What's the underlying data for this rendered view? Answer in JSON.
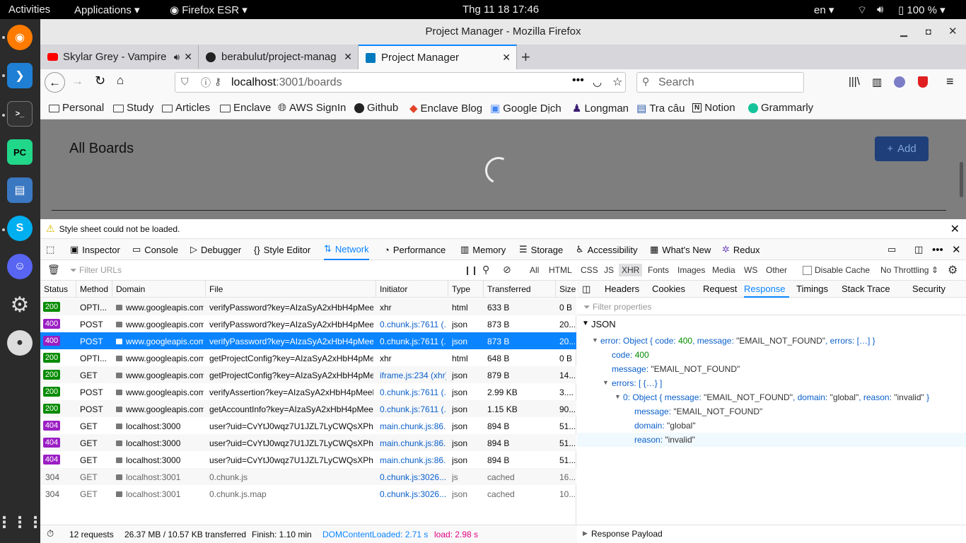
{
  "topbar": {
    "activities": "Activities",
    "applications": "Applications",
    "app": "Firefox ESR",
    "clock": "Thg 11 18  17:46",
    "lang": "en",
    "battery": "100 %"
  },
  "window": {
    "title": "Project Manager - Mozilla Firefox"
  },
  "tabs": [
    {
      "label": "Skylar Grey - Vampire"
    },
    {
      "label": "berabulut/project-manag"
    },
    {
      "label": "Project Manager"
    }
  ],
  "url": {
    "host": "localhost",
    "rest": ":3001/boards"
  },
  "search": {
    "placeholder": "Search"
  },
  "bookmarks": [
    "Personal",
    "Study",
    "Articles",
    "Enclave",
    "AWS SignIn",
    "Github",
    "Enclave Blog",
    "Google Dịch",
    "Longman",
    "Tra câu",
    "Notion",
    "Grammarly"
  ],
  "page": {
    "title": "All Boards",
    "add": "Add"
  },
  "warning": "Style sheet could not be loaded.",
  "devtools": {
    "tools": [
      "Inspector",
      "Console",
      "Debugger",
      "Style Editor",
      "Network",
      "Performance",
      "Memory",
      "Storage",
      "Accessibility",
      "What's New",
      "Redux"
    ],
    "filter_placeholder": "Filter URLs",
    "types": [
      "All",
      "HTML",
      "CSS",
      "JS",
      "XHR",
      "Fonts",
      "Images",
      "Media",
      "WS",
      "Other"
    ],
    "disable_cache": "Disable Cache",
    "throttle": "No Throttling",
    "columns": [
      "Status",
      "Method",
      "Domain",
      "File",
      "Initiator",
      "Type",
      "Transferred",
      "Size"
    ],
    "requests": [
      {
        "status": "200",
        "method": "OPTI...",
        "domain": "www.googleapis.com",
        "file": "verifyPassword?key=AIzaSyA2xHbH4pMeeh...",
        "initiator": "xhr",
        "type": "html",
        "transferred": "633 B",
        "size": "0 B"
      },
      {
        "status": "400",
        "method": "POST",
        "domain": "www.googleapis.com",
        "file": "verifyPassword?key=AIzaSyA2xHbH4pMeeh...",
        "initiator": "0.chunk.js:7611 (...",
        "type": "json",
        "transferred": "873 B",
        "size": "20..."
      },
      {
        "status": "400",
        "method": "POST",
        "domain": "www.googleapis.com",
        "file": "verifyPassword?key=AIzaSyA2xHbH4pMeeh...",
        "initiator": "0.chunk.js:7611 (...",
        "type": "json",
        "transferred": "873 B",
        "size": "20..."
      },
      {
        "status": "200",
        "method": "OPTI...",
        "domain": "www.googleapis.com",
        "file": "getProjectConfig?key=AIzaSyA2xHbH4pMee...",
        "initiator": "xhr",
        "type": "html",
        "transferred": "648 B",
        "size": "0 B"
      },
      {
        "status": "200",
        "method": "GET",
        "domain": "www.googleapis.com",
        "file": "getProjectConfig?key=AIzaSyA2xHbH4pMee...",
        "initiator": "iframe.js:234 (xhr)",
        "type": "json",
        "transferred": "879 B",
        "size": "14..."
      },
      {
        "status": "200",
        "method": "POST",
        "domain": "www.googleapis.com",
        "file": "verifyAssertion?key=AIzaSyA2xHbH4pMeeh...",
        "initiator": "0.chunk.js:7611 (...",
        "type": "json",
        "transferred": "2.99 KB",
        "size": "3...."
      },
      {
        "status": "200",
        "method": "POST",
        "domain": "www.googleapis.com",
        "file": "getAccountInfo?key=AIzaSyA2xHbH4pMeeh...",
        "initiator": "0.chunk.js:7611 (...",
        "type": "json",
        "transferred": "1.15 KB",
        "size": "90..."
      },
      {
        "status": "404",
        "method": "GET",
        "domain": "localhost:3000",
        "file": "user?uid=CvYtJ0wqz7U1JZL7LyCWQsXPhqX2",
        "initiator": "main.chunk.js:86...",
        "type": "json",
        "transferred": "894 B",
        "size": "51..."
      },
      {
        "status": "404",
        "method": "GET",
        "domain": "localhost:3000",
        "file": "user?uid=CvYtJ0wqz7U1JZL7LyCWQsXPhqX2",
        "initiator": "main.chunk.js:86...",
        "type": "json",
        "transferred": "894 B",
        "size": "51..."
      },
      {
        "status": "404",
        "method": "GET",
        "domain": "localhost:3000",
        "file": "user?uid=CvYtJ0wqz7U1JZL7LyCWQsXPhqX2",
        "initiator": "main.chunk.js:86...",
        "type": "json",
        "transferred": "894 B",
        "size": "51..."
      },
      {
        "status": "304",
        "method": "GET",
        "domain": "localhost:3001",
        "file": "0.chunk.js",
        "initiator": "0.chunk.js:3026...",
        "type": "js",
        "transferred": "cached",
        "size": "16..."
      },
      {
        "status": "304",
        "method": "GET",
        "domain": "localhost:3001",
        "file": "0.chunk.js.map",
        "initiator": "0.chunk.js:3026...",
        "type": "json",
        "transferred": "cached",
        "size": "10..."
      }
    ],
    "side_tabs": [
      "Headers",
      "Cookies",
      "Request",
      "Response",
      "Timings",
      "Stack Trace",
      "Security"
    ],
    "filter_props": "Filter properties",
    "json": {
      "section": "JSON",
      "error_line": {
        "k": "error:",
        "v1": "Object { code: ",
        "v2": "400",
        "v3": ", message: ",
        "v4": "\"EMAIL_NOT_FOUND\"",
        "v5": ", errors: ",
        "v6": "[…]",
        "v7": " }"
      },
      "code": {
        "k": "code:",
        "v": "400"
      },
      "message": {
        "k": "message:",
        "v": "\"EMAIL_NOT_FOUND\""
      },
      "errors": {
        "k": "errors:",
        "v": "[ {…} ]"
      },
      "item0": {
        "k": "0:",
        "v1": "Object { message: ",
        "v2": "\"EMAIL_NOT_FOUND\"",
        "v3": ", domain: ",
        "v4": "\"global\"",
        "v5": ", reason: ",
        "v6": "\"invalid\"",
        "v7": " }"
      },
      "imessage": {
        "k": "message:",
        "v": "\"EMAIL_NOT_FOUND\""
      },
      "idomain": {
        "k": "domain:",
        "v": "\"global\""
      },
      "ireason": {
        "k": "reason:",
        "v": "\"invalid\""
      },
      "payload": "Response Payload"
    },
    "status": {
      "requests": "12 requests",
      "transferred": "26.37 MB / 10.57 KB transferred",
      "finish": "Finish: 1.10 min",
      "dcl": "DOMContentLoaded: 2.71 s",
      "load": "load: 2.98 s"
    }
  }
}
